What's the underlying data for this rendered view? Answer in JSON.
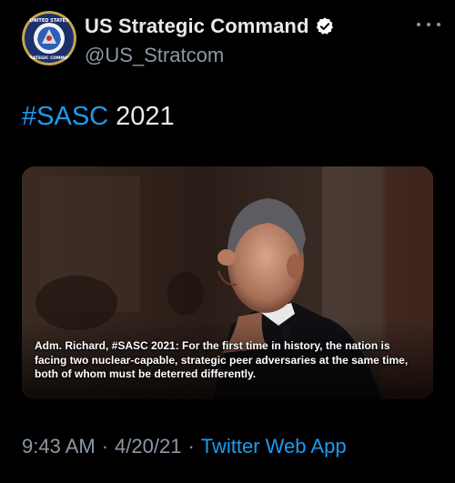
{
  "author": {
    "display_name": "US Strategic Command",
    "handle": "@US_Stratcom",
    "avatar_text_top": "UNITED STATES",
    "avatar_text_bottom": "STRATEGIC COMMAND",
    "verified": true
  },
  "tweet": {
    "hashtag": "#SASC",
    "text_rest": " 2021"
  },
  "media": {
    "caption": "Adm. Richard, #SASC 2021: For the first time in history, the nation is facing two nuclear-capable, strategic peer adversaries at the same time, both of whom must be deterred differently."
  },
  "meta": {
    "time": "9:43 AM",
    "separator": "·",
    "date": "4/20/21",
    "source": "Twitter Web App"
  },
  "colors": {
    "background": "#000000",
    "link": "#1d9bf0",
    "secondary_text": "#8b98a5",
    "primary_text": "#e7e9ea"
  },
  "icons": {
    "verified": "verified-badge-icon",
    "more": "more-options-icon"
  }
}
